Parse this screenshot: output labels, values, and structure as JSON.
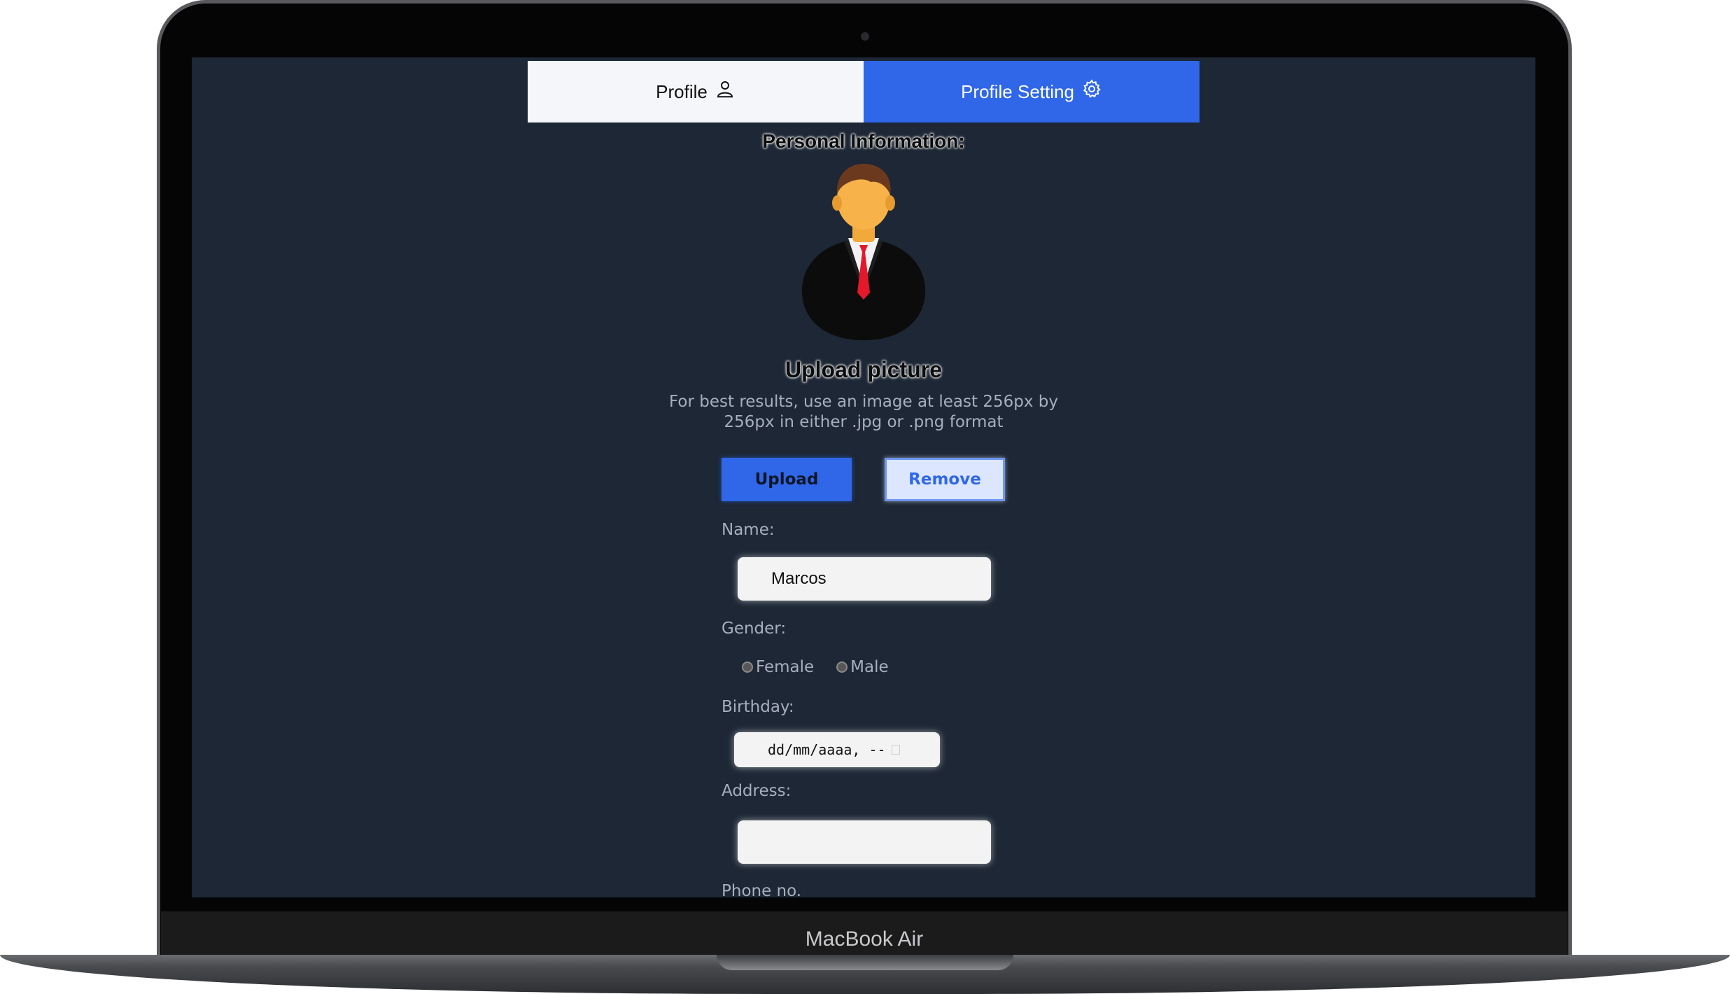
{
  "device": {
    "model_label": "MacBook Air"
  },
  "tabs": [
    {
      "label": "Profile",
      "icon": "user-icon",
      "active": false
    },
    {
      "label": "Profile Setting",
      "icon": "gear-icon",
      "active": true
    }
  ],
  "personal": {
    "title": "Personal Information:",
    "avatar_icon": "businessman-avatar-icon"
  },
  "upload": {
    "title": "Upload picture",
    "hint": "For best results, use an image at least 256px by 256px in either .jpg or .png format",
    "upload_label": "Upload",
    "remove_label": "Remove"
  },
  "form": {
    "name_label": "Name:",
    "name_value": "Marcos",
    "gender_label": "Gender:",
    "gender_options": [
      "Female",
      "Male"
    ],
    "birthday_label": "Birthday:",
    "birthday_placeholder": "dd/mm/aaaa, --",
    "address_label": "Address:",
    "address_value": "",
    "phone_label": "Phone no."
  },
  "colors": {
    "screen_bg": "#1d2735",
    "accent": "#2f67e8",
    "remove_bg": "#dce6ff",
    "label_text": "#a7afbc"
  }
}
